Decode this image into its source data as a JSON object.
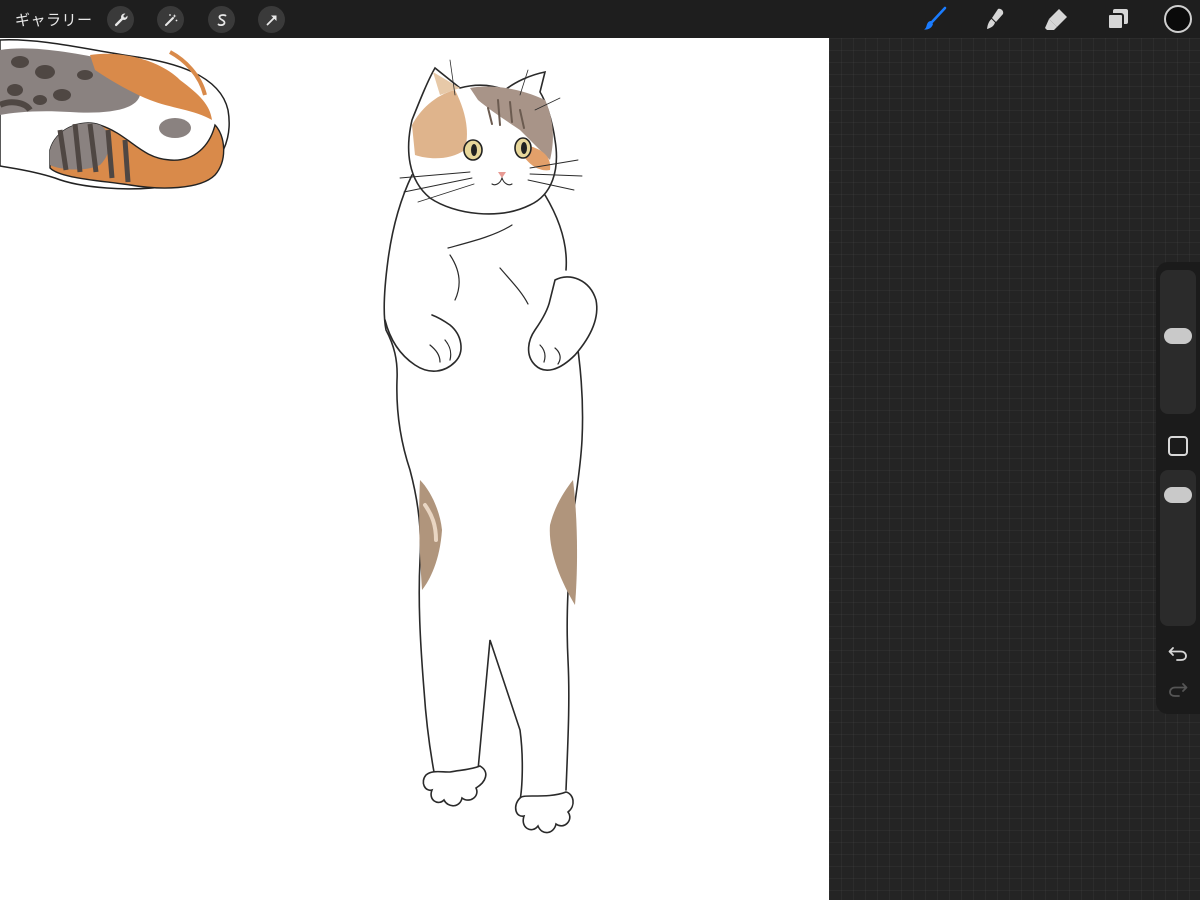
{
  "topbar": {
    "gallery_label": "ギャラリー",
    "left_tools": [
      {
        "icon": "wrench-icon",
        "label": "actions"
      },
      {
        "icon": "magic-wand-icon",
        "label": "adjustments"
      },
      {
        "icon": "selection-icon",
        "label": "selection"
      },
      {
        "icon": "arrow-cursor-icon",
        "label": "transform"
      }
    ],
    "right_tools": [
      {
        "icon": "brush-icon",
        "active": true
      },
      {
        "icon": "smudge-icon",
        "active": false
      },
      {
        "icon": "eraser-icon",
        "active": false
      },
      {
        "icon": "layers-icon",
        "active": false
      }
    ],
    "current_color": "#0a0a0a",
    "active_tool_color": "#1a7cff"
  },
  "sidebar": {
    "brush_size_level": 0.55,
    "opacity_level": 0.9,
    "controls": [
      "modify-button-icon",
      "undo-icon",
      "redo-icon"
    ]
  },
  "canvas": {
    "background": "#ffffff",
    "subject": "calico-cat-sketch"
  }
}
